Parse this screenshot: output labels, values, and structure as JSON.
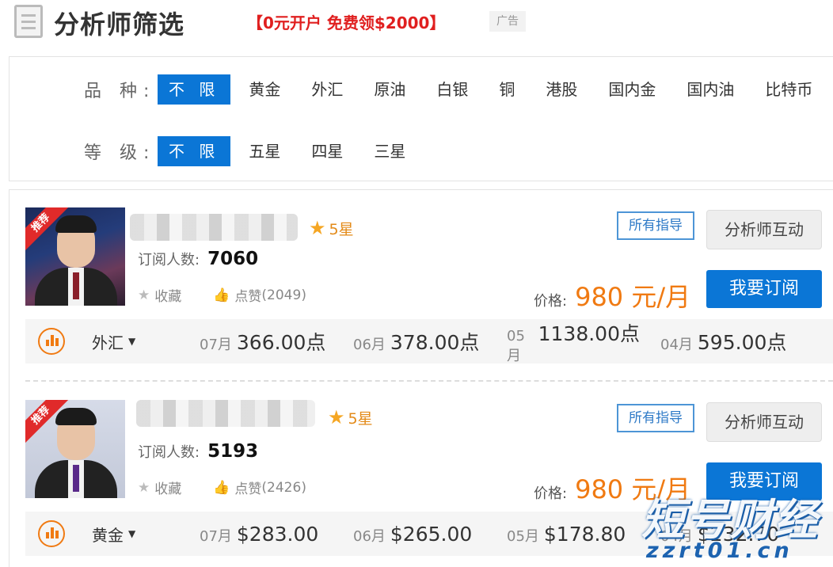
{
  "header": {
    "title": "分析师筛选",
    "promo": "【0元开户 免费领$2000】",
    "ad_badge": "广告"
  },
  "filters": {
    "variety": {
      "label": "品 种:",
      "options": [
        "不 限",
        "黄金",
        "外汇",
        "原油",
        "白银",
        "铜",
        "港股",
        "国内金",
        "国内油",
        "比特币"
      ],
      "selected": "不 限"
    },
    "grade": {
      "label": "等 级:",
      "options": [
        "不 限",
        "五星",
        "四星",
        "三星"
      ],
      "selected": "不 限"
    }
  },
  "analysts": [
    {
      "badge": "推荐",
      "rating": "5星",
      "subscribers_label": "订阅人数:",
      "subscribers": "7060",
      "favorite_label": "收藏",
      "like_label": "点赞",
      "like_count": "(2049)",
      "guide_button": "所有指导",
      "interact_button": "分析师互动",
      "price_label": "价格:",
      "price": "980 元/月",
      "subscribe_button": "我要订阅",
      "category": "外汇",
      "performance": [
        {
          "month": "07月",
          "value": "366.00点"
        },
        {
          "month": "06月",
          "value": "378.00点"
        },
        {
          "month": "05月",
          "value": "1138.00点"
        },
        {
          "month": "04月",
          "value": "595.00点"
        }
      ]
    },
    {
      "badge": "推荐",
      "rating": "5星",
      "subscribers_label": "订阅人数:",
      "subscribers": "5193",
      "favorite_label": "收藏",
      "like_label": "点赞",
      "like_count": "(2426)",
      "guide_button": "所有指导",
      "interact_button": "分析师互动",
      "price_label": "价格:",
      "price": "980 元/月",
      "subscribe_button": "我要订阅",
      "category": "黄金",
      "performance": [
        {
          "month": "07月",
          "value": "$283.00"
        },
        {
          "month": "06月",
          "value": "$265.00"
        },
        {
          "month": "05月",
          "value": "$178.80"
        },
        {
          "month": "04月",
          "value": "$232.70"
        }
      ]
    }
  ],
  "watermark": {
    "brand": "短号财经",
    "domain": "zzrt01.cn"
  },
  "colors": {
    "primary_blue": "#0b76d6",
    "price_orange": "#f07a12",
    "promo_red": "#e01f1f",
    "star_gold": "#f5a623"
  }
}
